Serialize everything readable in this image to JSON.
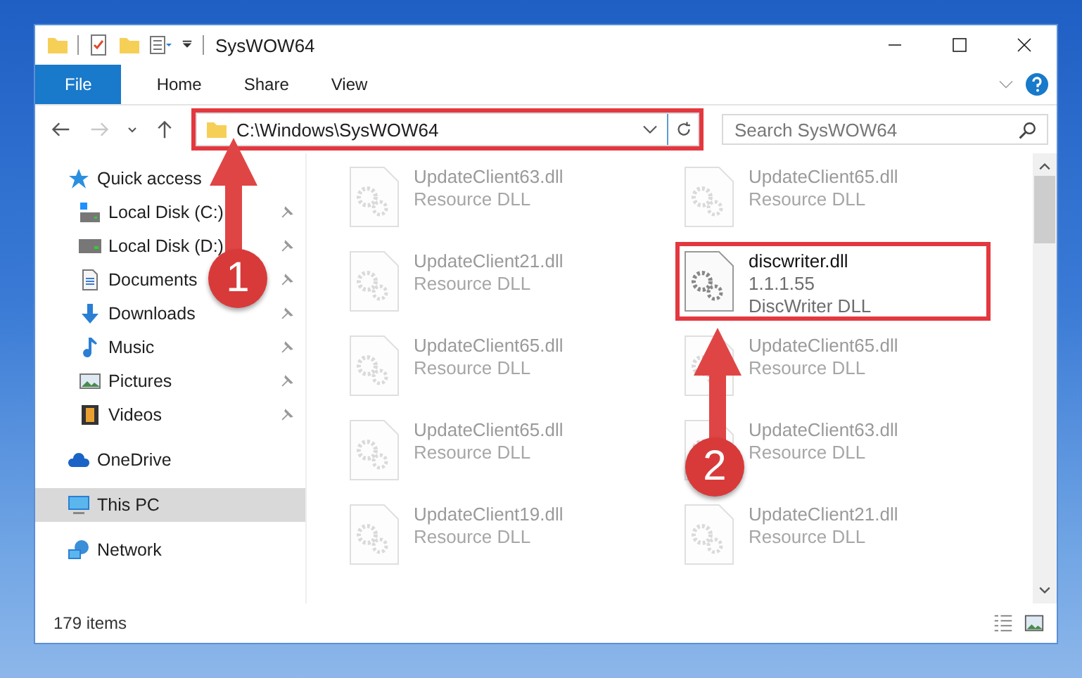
{
  "window": {
    "title": "SysWOW64"
  },
  "ribbon_tabs": [
    {
      "label": "File",
      "selected": true
    },
    {
      "label": "Home",
      "selected": false
    },
    {
      "label": "Share",
      "selected": false
    },
    {
      "label": "View",
      "selected": false
    }
  ],
  "navigation": {
    "forward_disabled": true
  },
  "address": {
    "path": "C:\\Windows\\SysWOW64",
    "highlighted": true
  },
  "search": {
    "placeholder": "Search SysWOW64"
  },
  "sidebar": {
    "items": [
      {
        "label": "Quick access",
        "kind": "star",
        "selected": false,
        "children": [
          {
            "label": "Local Disk (C:)",
            "kind": "system",
            "pinned": true
          },
          {
            "label": "Local Disk (D:)",
            "kind": "drive",
            "pinned": true
          },
          {
            "label": "Documents",
            "kind": "document",
            "pinned": true
          },
          {
            "label": "Downloads",
            "kind": "download",
            "pinned": true
          },
          {
            "label": "Music",
            "kind": "music",
            "pinned": true
          },
          {
            "label": "Pictures",
            "kind": "picture",
            "pinned": true
          },
          {
            "label": "Videos",
            "kind": "video",
            "pinned": true
          }
        ]
      },
      {
        "label": "OneDrive",
        "kind": "cloud",
        "selected": false
      },
      {
        "label": "This PC",
        "kind": "computer",
        "selected": true
      },
      {
        "label": "Network",
        "kind": "network",
        "selected": false
      }
    ]
  },
  "files": [
    {
      "name": "UpdateClient63.dll",
      "details": [
        "Resource DLL"
      ],
      "blurred": true,
      "highlighted": false
    },
    {
      "name": "UpdateClient65.dll",
      "details": [
        "Resource DLL"
      ],
      "blurred": true,
      "highlighted": false
    },
    {
      "name": "UpdateClient21.dll",
      "details": [
        "Resource DLL"
      ],
      "blurred": true,
      "highlighted": false
    },
    {
      "name": "discwriter.dll",
      "details": [
        "1.1.1.55",
        "DiscWriter DLL"
      ],
      "blurred": false,
      "highlighted": true
    },
    {
      "name": "UpdateClient65.dll",
      "details": [
        "Resource DLL"
      ],
      "blurred": true,
      "highlighted": false
    },
    {
      "name": "UpdateClient65.dll",
      "details": [
        "Resource DLL"
      ],
      "blurred": true,
      "highlighted": false
    },
    {
      "name": "UpdateClient65.dll",
      "details": [
        "Resource DLL"
      ],
      "blurred": true,
      "highlighted": false
    },
    {
      "name": "UpdateClient63.dll",
      "details": [
        "Resource DLL"
      ],
      "blurred": true,
      "highlighted": false
    },
    {
      "name": "UpdateClient19.dll",
      "details": [
        "Resource DLL"
      ],
      "blurred": true,
      "highlighted": false
    },
    {
      "name": "UpdateClient21.dll",
      "details": [
        "Resource DLL"
      ],
      "blurred": true,
      "highlighted": false
    }
  ],
  "status_bar": {
    "item_count": "179 items"
  },
  "callouts": [
    {
      "label": "1"
    },
    {
      "label": "2"
    }
  ]
}
